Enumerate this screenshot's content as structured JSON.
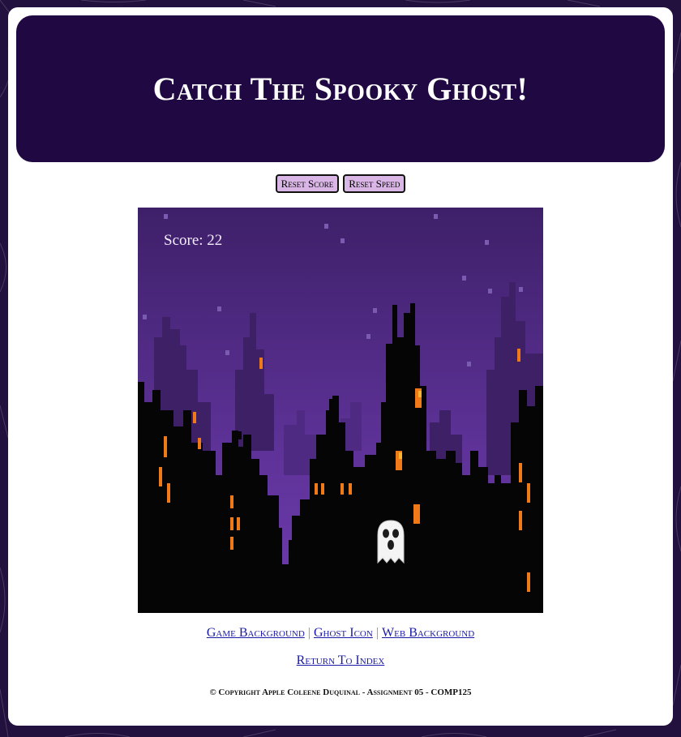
{
  "header": {
    "title": "Catch The Spooky Ghost!"
  },
  "controls": {
    "reset_score": "Reset Score",
    "reset_speed": "Reset Speed"
  },
  "game": {
    "score_label": "Score: 22",
    "score": 22,
    "ghost_icon": "ghost-icon",
    "colors": {
      "sky_top": "#40216c",
      "sky_bottom": "#6a3aa8",
      "city": "#050505",
      "window": "#f07a18"
    }
  },
  "links": {
    "game_background": "Game Background",
    "ghost_icon": "Ghost Icon",
    "web_background": "Web Background",
    "separator": "|",
    "return_index": "Return To Index"
  },
  "footer": {
    "copyright": "© Copyright Apple Coleene Duquinal - Assignment 05 - COMP125"
  }
}
